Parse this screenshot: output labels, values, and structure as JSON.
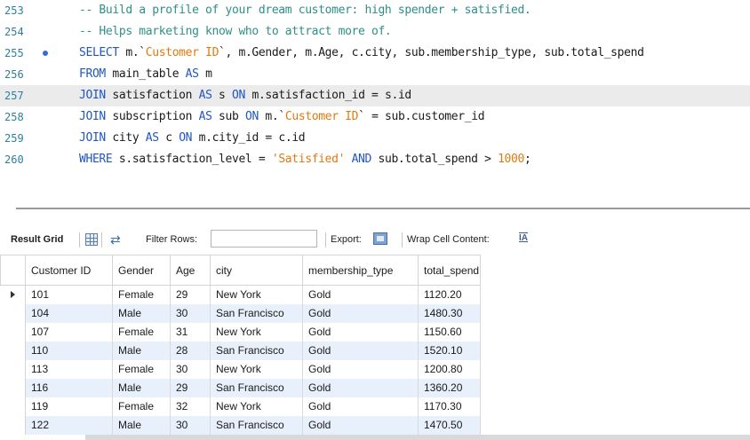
{
  "editor": {
    "breakpoint_line": "255",
    "lines": [
      {
        "num": "253",
        "parts": [
          {
            "cls": "cm",
            "text": "-- Build a profile of your dream customer: high spender + satisfied."
          }
        ]
      },
      {
        "num": "254",
        "parts": [
          {
            "cls": "cm",
            "text": "-- Helps marketing know who to attract more of."
          }
        ]
      },
      {
        "num": "255",
        "parts": [
          {
            "cls": "kw",
            "text": "SELECT"
          },
          {
            "cls": "id",
            "text": " m.`"
          },
          {
            "cls": "str",
            "text": "Customer ID"
          },
          {
            "cls": "id",
            "text": "`, m.Gender, m.Age, c.city, sub.membership_type, sub.total_spend"
          }
        ]
      },
      {
        "num": "256",
        "parts": [
          {
            "cls": "kw",
            "text": "FROM"
          },
          {
            "cls": "id",
            "text": " main_table "
          },
          {
            "cls": "kw",
            "text": "AS"
          },
          {
            "cls": "id",
            "text": " m"
          }
        ]
      },
      {
        "num": "257",
        "parts": [
          {
            "cls": "kw",
            "text": "JOIN"
          },
          {
            "cls": "id",
            "text": " satisfaction "
          },
          {
            "cls": "kw",
            "text": "AS"
          },
          {
            "cls": "id",
            "text": " s "
          },
          {
            "cls": "kw",
            "text": "ON"
          },
          {
            "cls": "id",
            "text": " m.satisfaction_id = s.id"
          }
        ]
      },
      {
        "num": "258",
        "parts": [
          {
            "cls": "kw",
            "text": "JOIN"
          },
          {
            "cls": "id",
            "text": " subscription "
          },
          {
            "cls": "kw",
            "text": "AS"
          },
          {
            "cls": "id",
            "text": " sub "
          },
          {
            "cls": "kw",
            "text": "ON"
          },
          {
            "cls": "id",
            "text": " m.`"
          },
          {
            "cls": "str",
            "text": "Customer ID"
          },
          {
            "cls": "id",
            "text": "` = sub.customer_id"
          }
        ]
      },
      {
        "num": "259",
        "parts": [
          {
            "cls": "kw",
            "text": "JOIN"
          },
          {
            "cls": "id",
            "text": " city "
          },
          {
            "cls": "kw",
            "text": "AS"
          },
          {
            "cls": "id",
            "text": " c "
          },
          {
            "cls": "kw",
            "text": "ON"
          },
          {
            "cls": "id",
            "text": " m.city_id = c.id"
          }
        ]
      },
      {
        "num": "260",
        "parts": [
          {
            "cls": "kw",
            "text": "WHERE"
          },
          {
            "cls": "id",
            "text": " s.satisfaction_level = "
          },
          {
            "cls": "str",
            "text": "'Satisfied'"
          },
          {
            "cls": "id",
            "text": " "
          },
          {
            "cls": "kw",
            "text": "AND"
          },
          {
            "cls": "id",
            "text": " sub.total_spend > "
          },
          {
            "cls": "num",
            "text": "1000"
          },
          {
            "cls": "id",
            "text": ";"
          }
        ]
      }
    ],
    "highlighted_line": "257"
  },
  "toolbar": {
    "result_grid_label": "Result Grid",
    "filter_rows_label": "Filter Rows:",
    "filter_value": "",
    "export_label": "Export:",
    "wrap_label": "Wrap Cell Content:",
    "wrap_icon_text": "IA"
  },
  "grid": {
    "columns": [
      "Customer ID",
      "Gender",
      "Age",
      "city",
      "membership_type",
      "total_spend"
    ],
    "column_widths": [
      98,
      65,
      45,
      104,
      130,
      70
    ],
    "rows": [
      [
        "101",
        "Female",
        "29",
        "New York",
        "Gold",
        "1120.20"
      ],
      [
        "104",
        "Male",
        "30",
        "San Francisco",
        "Gold",
        "1480.30"
      ],
      [
        "107",
        "Female",
        "31",
        "New York",
        "Gold",
        "1150.60"
      ],
      [
        "110",
        "Male",
        "28",
        "San Francisco",
        "Gold",
        "1520.10"
      ],
      [
        "113",
        "Female",
        "30",
        "New York",
        "Gold",
        "1200.80"
      ],
      [
        "116",
        "Male",
        "29",
        "San Francisco",
        "Gold",
        "1360.20"
      ],
      [
        "119",
        "Female",
        "32",
        "New York",
        "Gold",
        "1170.30"
      ],
      [
        "122",
        "Male",
        "30",
        "San Francisco",
        "Gold",
        "1470.50"
      ]
    ],
    "selected_row": 0
  },
  "colors": {
    "keyword": "#1f55c4",
    "comment": "#2e8f88",
    "string": "#e07a10",
    "line_number": "#2e7f9a",
    "row_alt": "#e8f0fb"
  }
}
